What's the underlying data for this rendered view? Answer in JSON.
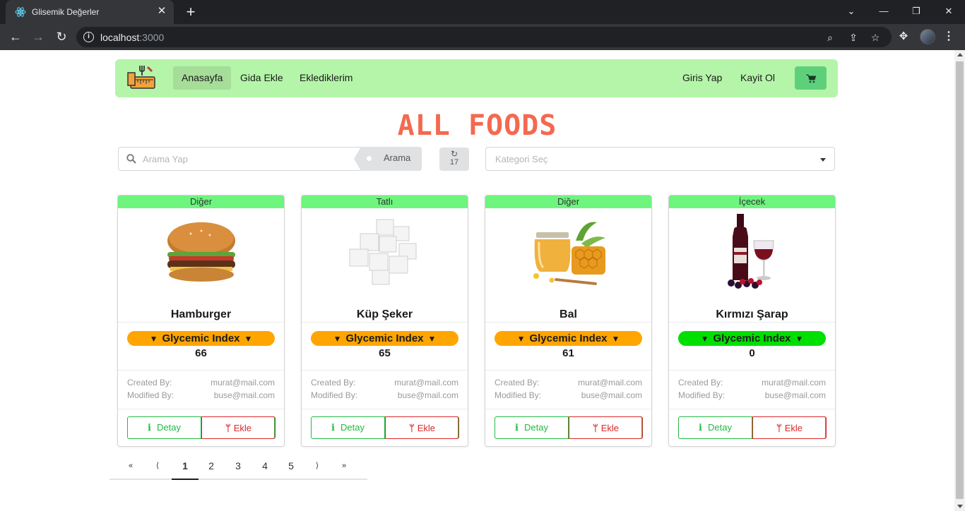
{
  "browser": {
    "tab_title": "Glisemik Değerler",
    "url_host": "localhost",
    "url_port": ":3000"
  },
  "navbar": {
    "items": [
      {
        "label": "Anasayfa",
        "active": true
      },
      {
        "label": "Gida Ekle",
        "active": false
      },
      {
        "label": "Eklediklerim",
        "active": false
      }
    ],
    "login": "Giris Yap",
    "register": "Kayit Ol"
  },
  "page": {
    "title": "ALL FOODS",
    "search_placeholder": "Arama Yap",
    "search_button": "Arama",
    "count": "17",
    "category_placeholder": "Kategori Seç"
  },
  "foods": [
    {
      "category": "Diğer",
      "name": "Hamburger",
      "gi_label": "Glycemic Index",
      "gi_value": "66",
      "gi_color": "#ffa500",
      "created_label": "Created By:",
      "created_by": "murat@mail.com",
      "modified_label": "Modified By:",
      "modified_by": "buse@mail.com",
      "detail_label": "Detay",
      "add_label": "Ekle",
      "image": "hamburger"
    },
    {
      "category": "Tatlı",
      "name": "Küp Şeker",
      "gi_label": "Glycemic Index",
      "gi_value": "65",
      "gi_color": "#ffa500",
      "created_label": "Created By:",
      "created_by": "murat@mail.com",
      "modified_label": "Modified By:",
      "modified_by": "buse@mail.com",
      "detail_label": "Detay",
      "add_label": "Ekle",
      "image": "sugar-cubes"
    },
    {
      "category": "Diğer",
      "name": "Bal",
      "gi_label": "Glycemic Index",
      "gi_value": "61",
      "gi_color": "#ffa500",
      "created_label": "Created By:",
      "created_by": "murat@mail.com",
      "modified_label": "Modified By:",
      "modified_by": "buse@mail.com",
      "detail_label": "Detay",
      "add_label": "Ekle",
      "image": "honey"
    },
    {
      "category": "İçecek",
      "name": "Kırmızı Şarap",
      "gi_label": "Glycemic Index",
      "gi_value": "0",
      "gi_color": "#00e000",
      "created_label": "Created By:",
      "created_by": "murat@mail.com",
      "modified_label": "Modified By:",
      "modified_by": "buse@mail.com",
      "detail_label": "Detay",
      "add_label": "Ekle",
      "image": "red-wine"
    }
  ],
  "pagination": {
    "first": "«",
    "prev": "⟨",
    "pages": [
      "1",
      "2",
      "3",
      "4",
      "5"
    ],
    "active_page": "1",
    "next": "⟩",
    "last": "»"
  }
}
